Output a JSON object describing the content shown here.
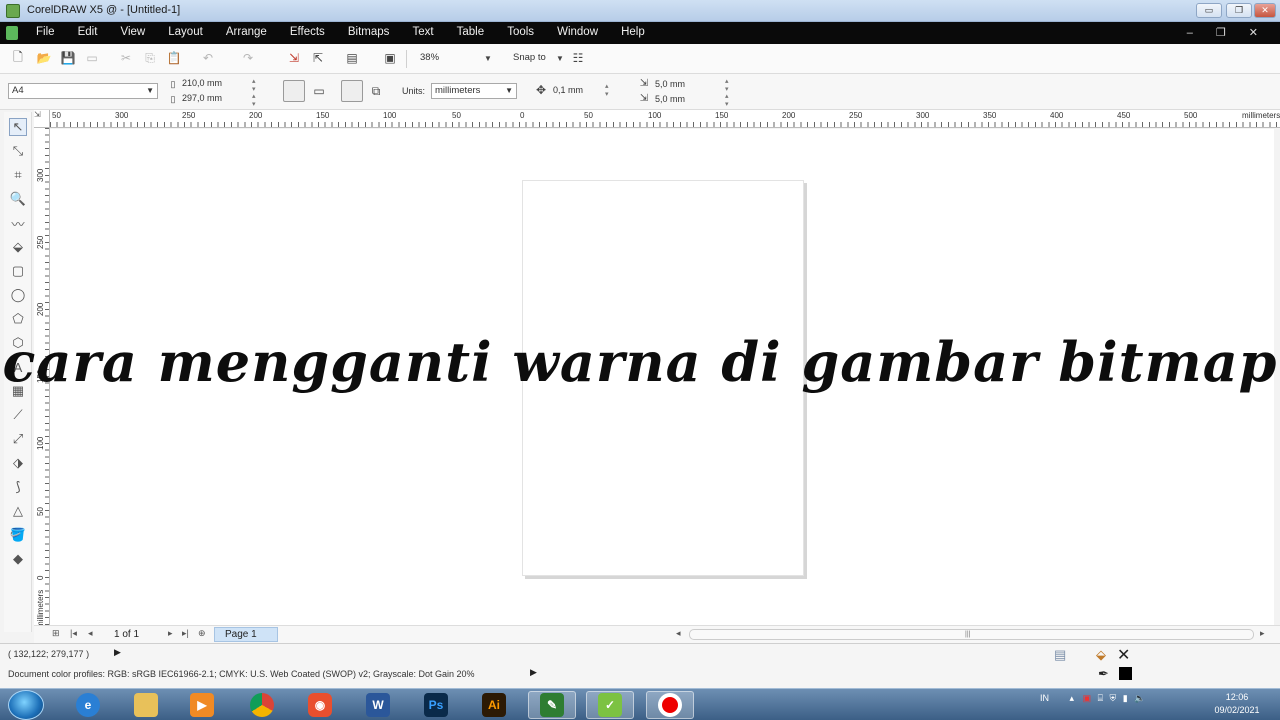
{
  "window": {
    "title": "CorelDRAW X5 @ - [Untitled-1]",
    "controls": {
      "minimize": "▭",
      "restore": "❐",
      "close": "✕"
    }
  },
  "menu": {
    "items": [
      "File",
      "Edit",
      "View",
      "Layout",
      "Arrange",
      "Effects",
      "Bitmaps",
      "Text",
      "Table",
      "Tools",
      "Window",
      "Help"
    ],
    "mdi_controls": "– ❐ ✕"
  },
  "standard_toolbar": {
    "zoom_level": "38%",
    "snap_to": "Snap to"
  },
  "property_bar": {
    "paper_size": "A4",
    "width": "210,0 mm",
    "height": "297,0 mm",
    "units_label": "Units:",
    "units": "millimeters",
    "nudge": "0,1 mm",
    "duplicate_x": "5,0 mm",
    "duplicate_y": "5,0 mm"
  },
  "ruler_h": {
    "labels": [
      "50",
      "300",
      "250",
      "200",
      "150",
      "100",
      "50",
      "0",
      "50",
      "100",
      "150",
      "200",
      "250",
      "300",
      "350",
      "400",
      "450",
      "500"
    ],
    "unit": "millimeters"
  },
  "ruler_v": {
    "labels": [
      "300",
      "250",
      "200",
      "150",
      "100",
      "50",
      "0"
    ],
    "unit": "millimeters"
  },
  "overlay": {
    "caption": "cara mengganti warna di gambar bitmap"
  },
  "page_nav": {
    "count": "1 of 1",
    "tab": "Page 1"
  },
  "status": {
    "coords": "( 132,122; 279,177 )",
    "profiles": "Document color profiles: RGB: sRGB IEC61966-2.1; CMYK: U.S. Web Coated (SWOP) v2; Grayscale: Dot Gain 20%"
  },
  "taskbar": {
    "apps": [
      "windows-explorer",
      "internet-explorer",
      "file-manager",
      "media-player",
      "chrome",
      "screen-recorder",
      "word",
      "photoshop",
      "illustrator",
      "coreldraw",
      "corel-capture",
      "recorder"
    ],
    "tray_lang": "IN",
    "time": "12:06",
    "date": "09/02/2021"
  },
  "colors": {
    "menubar": "#0a0a0a",
    "canvas": "#ffffff",
    "page_tab": "#cfe3f7",
    "taskbar": "#3c5f86"
  }
}
